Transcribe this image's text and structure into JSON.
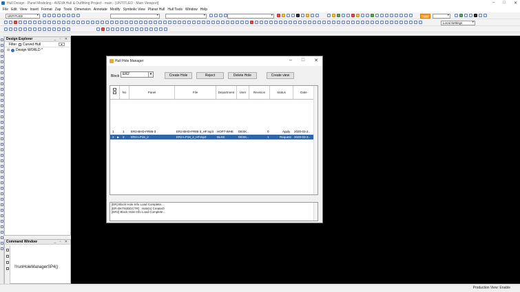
{
  "window": {
    "title": "Hull Design - Panel Modeling - AVEVA Hull & Outfitting Project - main - [UNTITLED - Main Viewport]",
    "controls": [
      "–",
      "□",
      "✕"
    ]
  },
  "menu": [
    "File",
    "Edit",
    "View",
    "Insert",
    "Format",
    "Zap",
    "Tools",
    "Dimension",
    "Annotate",
    "Modify",
    "Symbolic View",
    "Planar Hull",
    "Hull Tools",
    "Window",
    "Help"
  ],
  "toolbar": {
    "layer_combo": "UNTITLED",
    "auto_label": "Auto",
    "settings_combo": "Local Settings"
  },
  "explorer": {
    "title": "Design Explorer",
    "filter_label": "Filter",
    "filter_checkbox_label": "Curved Hull",
    "tree_root": "Design WORLD *"
  },
  "command_window": {
    "title": "Command Window",
    "text": "!!runHoleManagerSP4()"
  },
  "dialog": {
    "title": "Hull Hole Manager",
    "block_label": "Block",
    "block_value": "ER2",
    "buttons": {
      "create_hole": "Create Hole",
      "reject": "Reject",
      "delete_hole": "Delete Hole",
      "create_view": "Create view"
    },
    "grid": {
      "columns": [
        "No",
        "Panel",
        "File",
        "Department",
        "User",
        "Revision",
        "Status",
        "Date"
      ],
      "rows": [
        {
          "idx": "1",
          "no": "1",
          "panel": "ER2-BHD-FR85-3",
          "file": "ER2-BHD-FR85-3_HF.tsp3",
          "department": "HOFT-WHE",
          "user": "DESK..",
          "revision": "0",
          "status": "Apply",
          "date": "2020-03-2.."
        },
        {
          "idx": "2",
          "no": "2",
          "panel": "ER2-LP18_2",
          "file": "ER2-LP18_2_HF.tsp3",
          "department": "BLKE",
          "user": "DESK..",
          "revision": "1",
          "status": "Request",
          "date": "2020-03-3.."
        }
      ]
    },
    "log": [
      "[ER] Block Hole Info Load Complete...",
      "[ER-DKT92DDCTR] : Hole(s) Created!",
      "[ER2] Block Hole Info Load Complete..."
    ]
  },
  "status": {
    "text": "Production View: Enable"
  },
  "colors": {
    "viewport": "#000000",
    "selection": "#2f66a8",
    "accent": "#f6a23a"
  }
}
